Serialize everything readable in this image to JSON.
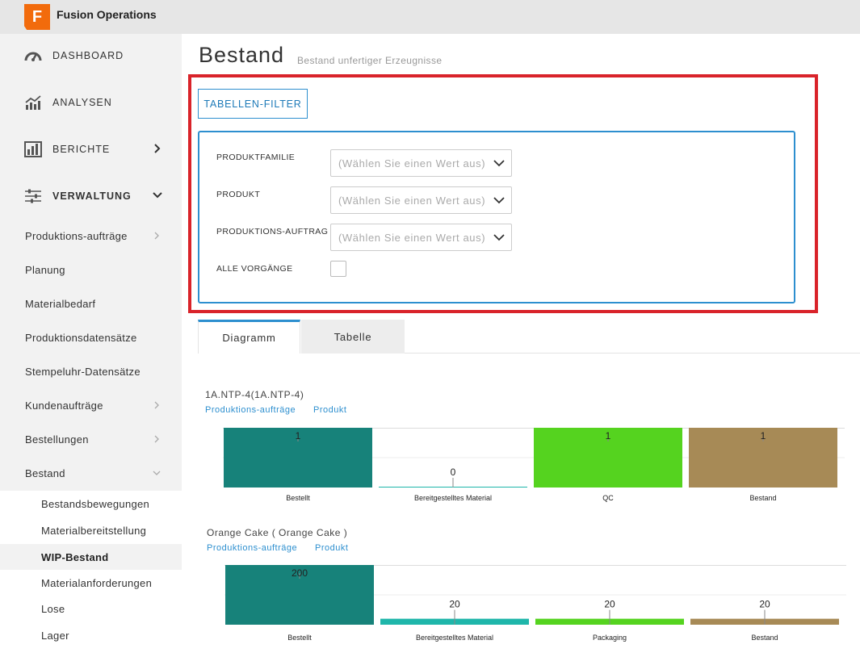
{
  "app": {
    "logo_letter": "F",
    "name": "Fusion Operations"
  },
  "sidebar": {
    "sections": [
      {
        "label": "DASHBOARD"
      },
      {
        "label": "ANALYSEN"
      },
      {
        "label": "BERICHTE"
      },
      {
        "label": "VERWALTUNG"
      }
    ],
    "items": [
      {
        "label": "Produktions-aufträge"
      },
      {
        "label": "Planung"
      },
      {
        "label": "Materialbedarf"
      },
      {
        "label": "Produktionsdatensätze"
      },
      {
        "label": "Stempeluhr-Datensätze"
      },
      {
        "label": "Kundenaufträge"
      },
      {
        "label": "Bestellungen"
      },
      {
        "label": "Bestand"
      }
    ],
    "subitems": [
      {
        "label": "Bestandsbewegungen"
      },
      {
        "label": "Materialbereitstellung"
      },
      {
        "label": "WIP-Bestand"
      },
      {
        "label": "Materialanforderungen"
      },
      {
        "label": "Lose"
      },
      {
        "label": "Lager"
      }
    ]
  },
  "page": {
    "title": "Bestand",
    "subtitle": "Bestand unfertiger Erzeugnisse"
  },
  "filter": {
    "button_label": "TABELLEN-FILTER",
    "fields": [
      {
        "label": "PRODUKTFAMILIE",
        "placeholder": "(Wählen Sie einen Wert aus)"
      },
      {
        "label": "PRODUKT",
        "placeholder": "(Wählen Sie einen Wert aus)"
      },
      {
        "label": "PRODUKTIONS-AUFTRAG",
        "placeholder": "(Wählen Sie einen Wert aus)"
      }
    ],
    "checkbox_label": "ALLE VORGÄNGE",
    "checkbox_checked": false
  },
  "tabs": [
    {
      "label": "Diagramm"
    },
    {
      "label": "Tabelle"
    }
  ],
  "colors": {
    "accent": "#2d8fcf",
    "highlight": "#d9232a"
  },
  "chart_data": [
    {
      "type": "bar",
      "title": "1A.NTP-4(1A.NTP-4)",
      "links": [
        "Produktions-aufträge",
        "Produkt"
      ],
      "categories": [
        "Bestellt",
        "Bereitgestelltes Material",
        "QC",
        "Bestand"
      ],
      "values": [
        1,
        0,
        1,
        1
      ],
      "colors": [
        "#17827a",
        "#1fb6aa",
        "#55d31f",
        "#a78a56"
      ],
      "ylim": [
        0,
        1
      ],
      "grid": true
    },
    {
      "type": "bar",
      "title": "Orange Cake ( Orange Cake )",
      "links": [
        "Produktions-aufträge",
        "Produkt"
      ],
      "categories": [
        "Bestellt",
        "Bereitgestelltes Material",
        "Packaging",
        "Bestand"
      ],
      "values": [
        200,
        20,
        20,
        20
      ],
      "colors": [
        "#17827a",
        "#1fb6aa",
        "#55d31f",
        "#a78a56"
      ],
      "ylim": [
        0,
        200
      ],
      "grid": true
    }
  ]
}
